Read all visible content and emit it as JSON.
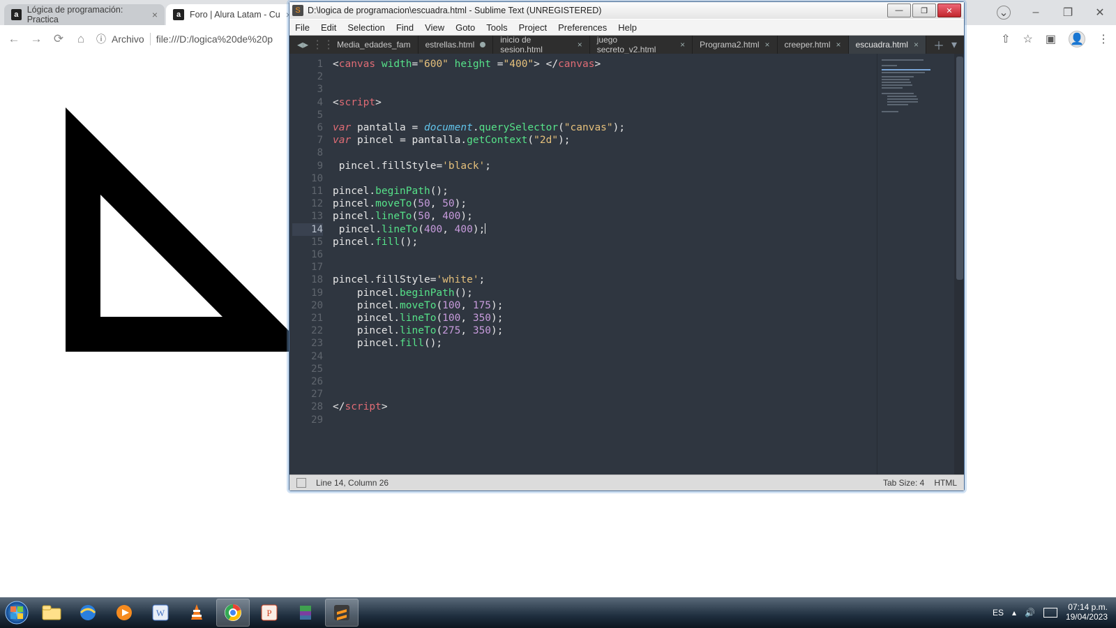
{
  "chrome": {
    "tabs": [
      {
        "label": "Lógica de programación: Practica"
      },
      {
        "label": "Foro | Alura Latam - Cu"
      }
    ],
    "addr_scheme": "Archivo",
    "addr_url": "file:///D:/logica%20de%20p",
    "nav": {
      "back": "←",
      "fwd": "→",
      "reload": "⟳",
      "home": "⌂",
      "info": "ⓘ"
    },
    "actions": {
      "share": "⇧",
      "star": "☆",
      "panel": "▣",
      "menu": "⋮"
    },
    "sys": {
      "dropdown": "⌄",
      "min": "–",
      "max": "❐",
      "close": "✕"
    }
  },
  "sublime": {
    "title": "D:\\logica de programacion\\escuadra.html - Sublime Text (UNREGISTERED)",
    "menus": [
      "File",
      "Edit",
      "Selection",
      "Find",
      "View",
      "Goto",
      "Tools",
      "Project",
      "Preferences",
      "Help"
    ],
    "tabs": [
      {
        "label": "Media_edades_fam",
        "dirty": true
      },
      {
        "label": "estrellas.html",
        "dirty": true
      },
      {
        "label": "inicio de sesion.html"
      },
      {
        "label": "juego secreto_v2.html"
      },
      {
        "label": "Programa2.html"
      },
      {
        "label": "creeper.html"
      },
      {
        "label": "escuadra.html",
        "active": true
      }
    ],
    "status_left": "Line 14, Column 26",
    "status_tab": "Tab Size: 4",
    "status_lang": "HTML",
    "line_count": 29,
    "highlight_line": 14,
    "winbtns": {
      "min": "—",
      "max": "❐",
      "close": "✕"
    }
  },
  "taskbar": {
    "lang": "ES",
    "time": "07:14 p.m.",
    "date": "19/04/2023"
  }
}
